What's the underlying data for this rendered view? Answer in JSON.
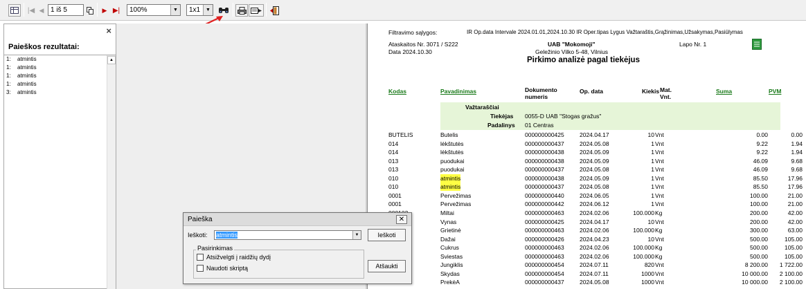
{
  "toolbar": {
    "page_field": "1 iš 5",
    "zoom_value": "100%",
    "layout_value": "1x1"
  },
  "search_panel": {
    "title": "Paieškos rezultatai:",
    "close": "×",
    "results": [
      {
        "n": "1:",
        "text": "atmintis"
      },
      {
        "n": "1:",
        "text": "atmintis"
      },
      {
        "n": "1:",
        "text": "atmintis"
      },
      {
        "n": "1:",
        "text": "atmintis"
      },
      {
        "n": "3:",
        "text": "atmintis"
      }
    ]
  },
  "report": {
    "filter_label": "Filtravimo sąlygos:",
    "filter_text": "IR Op.data Intervale 2024.01.01,2024.10.30 IR Oper.tipas Lygus Važtaraštis,Grąžinimas,Užsakymas,Pasiūlymas",
    "report_no": "Ataskaitos Nr.  3071 / S222",
    "date": "Data  2024.10.30",
    "company": "UAB \"Mokomoji\"",
    "address": "Geležinio Vilko 5-48, Vilnius",
    "page_no": "Lapo Nr.  1",
    "title": "Pirkimo analizė pagal tiekėjus",
    "columns": {
      "kodas": "Kodas",
      "pavadinimas": "Pavadinimas",
      "dok_1": "Dokumento",
      "dok_2": "numeris",
      "op_data": "Op. data",
      "kiekis": "Kiekis",
      "mat_1": "Mat.",
      "mat_2": "Vnt.",
      "suma": "Suma",
      "pvm": "PVM"
    },
    "group": {
      "vaztarasciai": "Važtaraščiai",
      "tiekejas_label": "Tiekėjas",
      "tiekejas_value": "0055-D UAB \"Stogas gražus\"",
      "padalinys_label": "Padalinys",
      "padalinys_value": "01 Centras"
    },
    "rows": [
      {
        "kodas": "BUTELIS",
        "pav": "Butelis",
        "dok": "000000000425",
        "data": "2024.04.17",
        "kiekis": "10",
        "vnt": "Vnt",
        "suma": "0.00",
        "pvm": "0.00",
        "hl": false
      },
      {
        "kodas": "014",
        "pav": "lėkštutės",
        "dok": "000000000437",
        "data": "2024.05.08",
        "kiekis": "1",
        "vnt": "Vnt",
        "suma": "9.22",
        "pvm": "1.94",
        "hl": false
      },
      {
        "kodas": "014",
        "pav": "lėkštutės",
        "dok": "000000000438",
        "data": "2024.05.09",
        "kiekis": "1",
        "vnt": "Vnt",
        "suma": "9.22",
        "pvm": "1.94",
        "hl": false
      },
      {
        "kodas": "013",
        "pav": "puodukai",
        "dok": "000000000438",
        "data": "2024.05.09",
        "kiekis": "1",
        "vnt": "Vnt",
        "suma": "46.09",
        "pvm": "9.68",
        "hl": false
      },
      {
        "kodas": "013",
        "pav": "puodukai",
        "dok": "000000000437",
        "data": "2024.05.08",
        "kiekis": "1",
        "vnt": "Vnt",
        "suma": "46.09",
        "pvm": "9.68",
        "hl": false
      },
      {
        "kodas": "010",
        "pav": "atmintis",
        "dok": "000000000438",
        "data": "2024.05.09",
        "kiekis": "1",
        "vnt": "Vnt",
        "suma": "85.50",
        "pvm": "17.96",
        "hl": true
      },
      {
        "kodas": "010",
        "pav": "atmintis",
        "dok": "000000000437",
        "data": "2024.05.08",
        "kiekis": "1",
        "vnt": "Vnt",
        "suma": "85.50",
        "pvm": "17.96",
        "hl": true
      },
      {
        "kodas": "0001",
        "pav": "Pervežimas",
        "dok": "000000000440",
        "data": "2024.06.05",
        "kiekis": "1",
        "vnt": "Vnt",
        "suma": "100.00",
        "pvm": "21.00",
        "hl": false
      },
      {
        "kodas": "0001",
        "pav": "Pervežimas",
        "dok": "000000000442",
        "data": "2024.06.12",
        "kiekis": "1",
        "vnt": "Vnt",
        "suma": "100.00",
        "pvm": "21.00",
        "hl": false
      },
      {
        "kodas": "000102",
        "pav": "Miltai",
        "dok": "000000000463",
        "data": "2024.02.06",
        "kiekis": "100.000",
        "vnt": "Kg",
        "suma": "200.00",
        "pvm": "42.00",
        "hl": false
      },
      {
        "kodas": "",
        "pav": "Vynas",
        "dok": "000000000425",
        "data": "2024.04.17",
        "kiekis": "10",
        "vnt": "Vnt",
        "suma": "200.00",
        "pvm": "42.00",
        "hl": false
      },
      {
        "kodas": "",
        "pav": "Grietinė",
        "dok": "000000000463",
        "data": "2024.02.06",
        "kiekis": "100.000",
        "vnt": "Kg",
        "suma": "300.00",
        "pvm": "63.00",
        "hl": false
      },
      {
        "kodas": "00001",
        "pav": "Dažai",
        "dok": "000000000426",
        "data": "2024.04.23",
        "kiekis": "10",
        "vnt": "Vnt",
        "suma": "500.00",
        "pvm": "105.00",
        "hl": false
      },
      {
        "kodas": "000103",
        "pav": "Cukrus",
        "dok": "000000000463",
        "data": "2024.02.06",
        "kiekis": "100.000",
        "vnt": "Kg",
        "suma": "500.00",
        "pvm": "105.00",
        "hl": false
      },
      {
        "kodas": "",
        "pav": "Sviestas",
        "dok": "000000000463",
        "data": "2024.02.06",
        "kiekis": "100.000",
        "vnt": "Kg",
        "suma": "500.00",
        "pvm": "105.00",
        "hl": false
      },
      {
        "kodas": "",
        "pav": "Jungiklis",
        "dok": "000000000454",
        "data": "2024.07.11",
        "kiekis": "820",
        "vnt": "Vnt",
        "suma": "8 200.00",
        "pvm": "1 722.00",
        "hl": false
      },
      {
        "kodas": "",
        "pav": "Skydas",
        "dok": "000000000454",
        "data": "2024.07.11",
        "kiekis": "1000",
        "vnt": "Vnt",
        "suma": "10 000.00",
        "pvm": "2 100.00",
        "hl": false
      },
      {
        "kodas": "",
        "pav": "PrekėA",
        "dok": "000000000437",
        "data": "2024.05.08",
        "kiekis": "1000",
        "vnt": "Vnt",
        "suma": "10 000.00",
        "pvm": "2 100.00",
        "hl": false
      }
    ]
  },
  "dialog": {
    "title": "Paieška",
    "close": "✕",
    "search_label": "Ieškoti:",
    "search_value": "atmintis",
    "search_button": "Ieškoti",
    "options_label": "Pasirinkimas",
    "case_label": "Atsižvelgti į raidžių dydį",
    "script_label": "Naudoti skriptą",
    "cancel_button": "Atšaukti"
  },
  "colors": {
    "highlight": "#ffff44",
    "group_bg": "#e6f5d8",
    "header_green": "#1a7a1a",
    "arrow": "#e02020"
  }
}
